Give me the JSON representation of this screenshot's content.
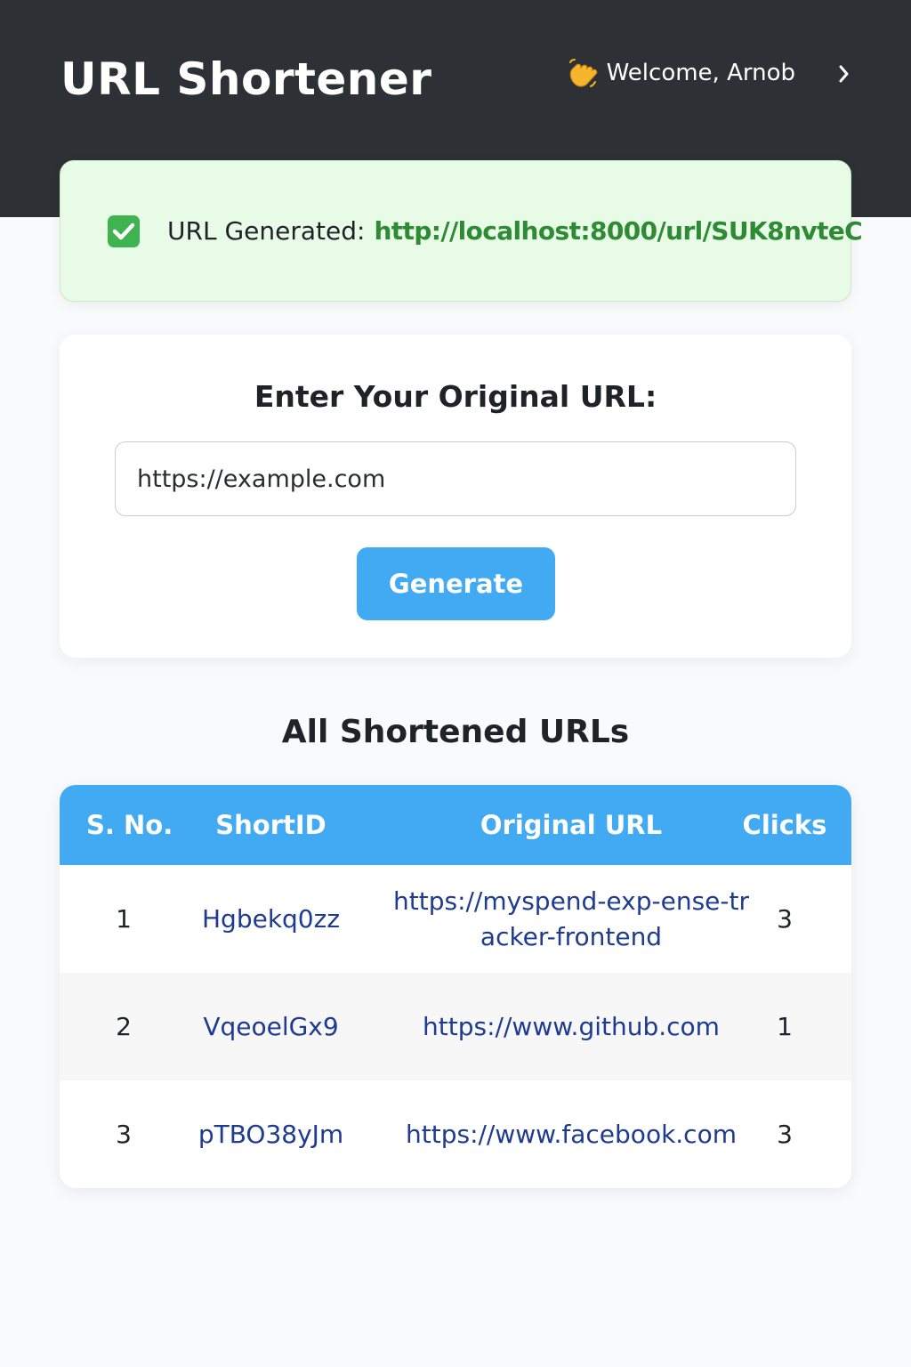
{
  "header": {
    "title": "URL Shortener",
    "welcome": "Welcome, Arnob"
  },
  "alert": {
    "label": "URL Generated:",
    "url": "http://localhost:8000/url/SUK8nvteC"
  },
  "form": {
    "title": "Enter Your Original URL:",
    "input_value": "https://example.com",
    "button_label": "Generate"
  },
  "list": {
    "title": "All Shortened URLs",
    "columns": [
      "S. No.",
      "ShortID",
      "Original URL",
      "Clicks"
    ],
    "rows": [
      {
        "sno": "1",
        "short_id": "Hgbekq0zz",
        "original_url": "https://myspend-exp-ense-tracker-frontend",
        "clicks": "3"
      },
      {
        "sno": "2",
        "short_id": "VqeoelGx9",
        "original_url": "https://www.github.com",
        "clicks": "1"
      },
      {
        "sno": "3",
        "short_id": "pTBO38yJm",
        "original_url": "https://www.facebook.com",
        "clicks": "3"
      }
    ]
  },
  "colors": {
    "header_bg": "#2d3035",
    "accent": "#42aaf3",
    "success_bg": "#e7fbe6",
    "success_text": "#2e8b34",
    "link_text": "#1e3b8f"
  }
}
